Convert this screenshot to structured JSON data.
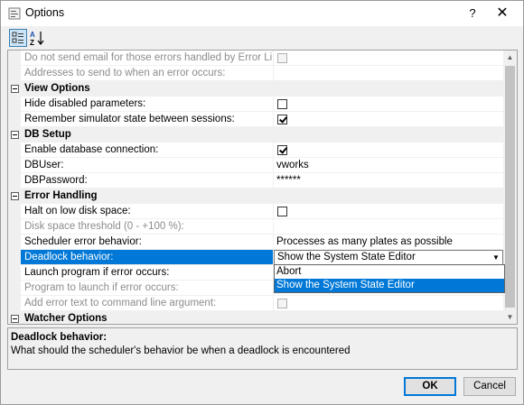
{
  "window": {
    "title": "Options",
    "help_label": "?",
    "close_label": "✕"
  },
  "toolbar": {
    "categorized_icon": "categorized-icon",
    "alphabetical_icon": "sort-az-icon"
  },
  "grid": {
    "rows": [
      {
        "type": "property",
        "name": "Do not send email for those errors handled by Error Library:",
        "value_type": "checkbox",
        "checked": false,
        "disabled": true
      },
      {
        "type": "property",
        "name": "Addresses to send to when an error occurs:",
        "value": "",
        "disabled": true
      },
      {
        "type": "category",
        "name": "View Options"
      },
      {
        "type": "property",
        "name": "Hide disabled parameters:",
        "value_type": "checkbox",
        "checked": false
      },
      {
        "type": "property",
        "name": "Remember simulator state between sessions:",
        "value_type": "checkbox",
        "checked": true
      },
      {
        "type": "category",
        "name": "DB Setup"
      },
      {
        "type": "property",
        "name": "Enable database connection:",
        "value_type": "checkbox",
        "checked": true
      },
      {
        "type": "property",
        "name": "DBUser:",
        "value": "vworks"
      },
      {
        "type": "property",
        "name": "DBPassword:",
        "value": "******"
      },
      {
        "type": "category",
        "name": "Error Handling"
      },
      {
        "type": "property",
        "name": "Halt on low disk space:",
        "value_type": "checkbox",
        "checked": false
      },
      {
        "type": "property",
        "name": "Disk space threshold (0 - +100 %):",
        "value": "",
        "disabled": true
      },
      {
        "type": "property",
        "name": "Scheduler error behavior:",
        "value": "Processes as many plates as possible"
      },
      {
        "type": "property",
        "name": "Deadlock behavior:",
        "value": "Show the System State Editor",
        "selected": true
      },
      {
        "type": "property",
        "name": "Launch program if error occurs:",
        "value": ""
      },
      {
        "type": "property",
        "name": "Program to launch if error occurs:",
        "value": "",
        "disabled": true
      },
      {
        "type": "property",
        "name": "Add error text to command line argument:",
        "value_type": "checkbox",
        "checked": false,
        "disabled": true
      },
      {
        "type": "category",
        "name": "Watcher Options"
      }
    ],
    "dropdown_options": [
      "Abort",
      "Show the System State Editor"
    ],
    "dropdown_highlighted": "Show the System State Editor"
  },
  "description": {
    "title": "Deadlock behavior:",
    "text": "What should the scheduler's behavior be when a deadlock is encountered"
  },
  "buttons": {
    "ok": "OK",
    "cancel": "Cancel"
  }
}
